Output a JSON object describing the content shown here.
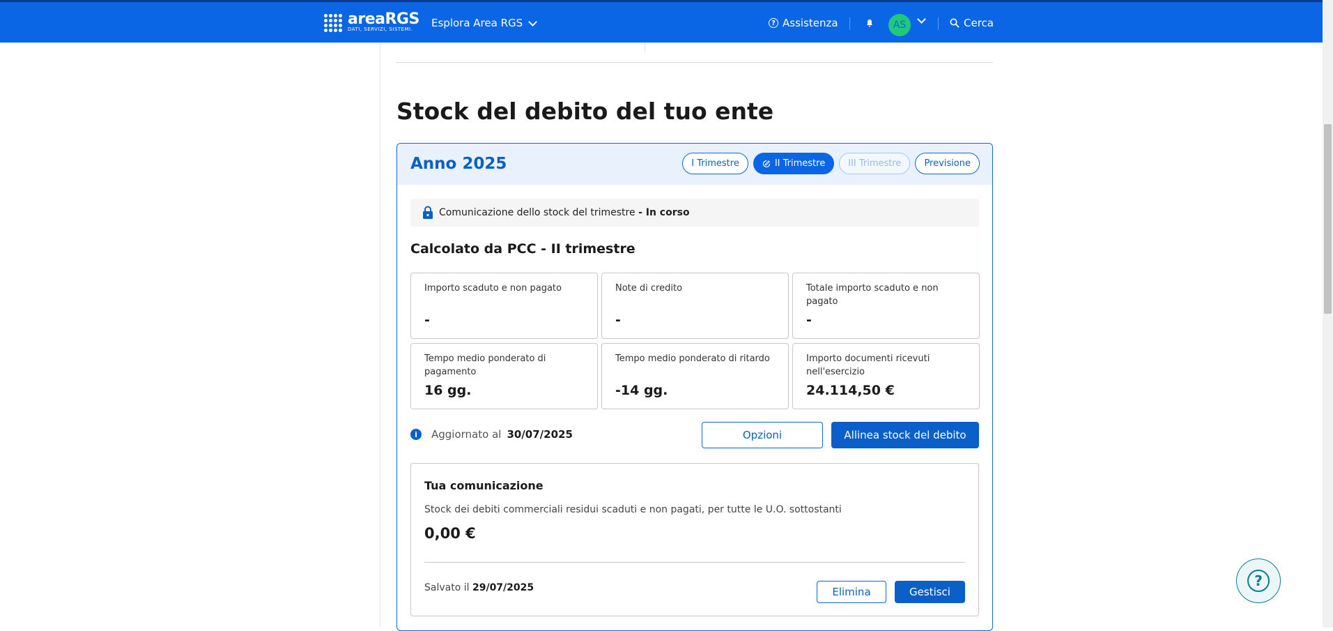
{
  "header": {
    "logo_main": "areaRGS",
    "logo_sub": "DATI, SERVIZI, SISTEMI.",
    "explore_label": "Esplora Area RGS",
    "help_label": "Assistenza",
    "avatar_initials": "AS",
    "search_label": "Cerca",
    "brand_color": "#0a66e4"
  },
  "page": {
    "title": "Stock del debito del tuo ente"
  },
  "card": {
    "year_label": "Anno 2025",
    "tabs": [
      {
        "label": "I Trimestre",
        "state": "default"
      },
      {
        "label": "II Trimestre",
        "state": "active"
      },
      {
        "label": "III Trimestre",
        "state": "disabled"
      },
      {
        "label": "Previsione",
        "state": "default"
      }
    ],
    "status": {
      "text": "Comunicazione dello stock del trimestre",
      "state": "- In corso"
    },
    "section_title": "Calcolato da PCC - II trimestre",
    "metrics": [
      {
        "label": "Importo scaduto e non pagato",
        "value": "-"
      },
      {
        "label": "Note di credito",
        "value": "-"
      },
      {
        "label": "Totale importo scaduto e non pagato",
        "value": "-"
      },
      {
        "label": "Tempo medio ponderato di pagamento",
        "value": "16 gg."
      },
      {
        "label": "Tempo medio ponderato di ritardo",
        "value": "-14 gg."
      },
      {
        "label": "Importo documenti ricevuti nell'esercizio",
        "value": "24.114,50 €"
      }
    ],
    "updated_label": "Aggiornato al",
    "updated_date": "30/07/2025",
    "options_button": "Opzioni",
    "align_button": "Allinea stock del debito",
    "communication": {
      "title": "Tua comunicazione",
      "description": "Stock dei debiti commerciali residui scaduti e non pagati, per tutte le U.O. sottostanti",
      "amount": "0,00 €",
      "saved_label": "Salvato il",
      "saved_date": "29/07/2025",
      "delete_button": "Elimina",
      "manage_button": "Gestisci"
    }
  }
}
